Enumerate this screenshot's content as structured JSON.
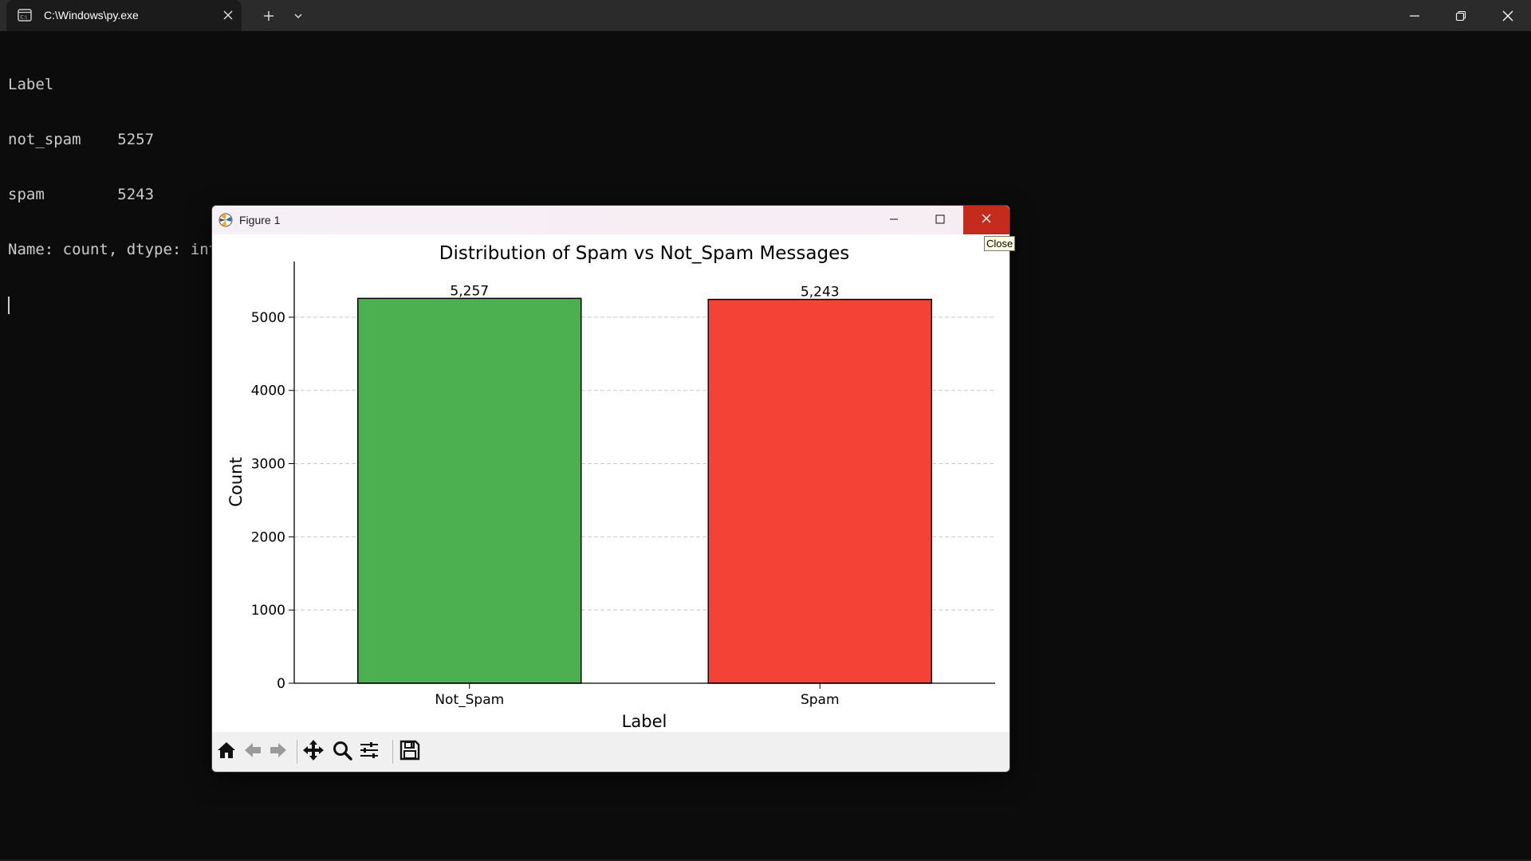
{
  "terminal": {
    "tab_title": "C:\\Windows\\py.exe",
    "lines": [
      "Label",
      "not_spam    5257",
      "spam        5243",
      "Name: count, dtype: int64"
    ]
  },
  "figure_window": {
    "title": "Figure 1",
    "tooltip": "Close"
  },
  "icons": {
    "terminal": "terminal-icon",
    "close": "close-icon",
    "new_tab": "plus-icon",
    "dropdown": "chevron-down-icon",
    "minimize": "minimize-icon",
    "restore": "restore-icon",
    "maximize": "maximize-icon",
    "figure_app": "matplotlib-icon",
    "home": "home-icon",
    "back": "arrow-left-icon",
    "forward": "arrow-right-icon",
    "pan": "move-icon",
    "zoom": "magnifier-icon",
    "configure": "sliders-icon",
    "save": "save-icon"
  },
  "colors": {
    "not_spam_bar": "#4caf50",
    "spam_bar": "#f44336",
    "close_button": "#c42b1c",
    "terminal_bg": "#0c0c0c",
    "terminal_text": "#cccccc"
  },
  "chart_data": {
    "type": "bar",
    "title": "Distribution of Spam vs Not_Spam Messages",
    "xlabel": "Label",
    "ylabel": "Count",
    "categories": [
      "Not_Spam",
      "Spam"
    ],
    "values": [
      5257,
      5243
    ],
    "data_labels": [
      "5,257",
      "5,243"
    ],
    "bar_colors": [
      "#4caf50",
      "#f44336"
    ],
    "ylim": [
      0,
      5500
    ],
    "yticks": [
      0,
      1000,
      2000,
      3000,
      4000,
      5000
    ],
    "grid": "y dashed"
  }
}
